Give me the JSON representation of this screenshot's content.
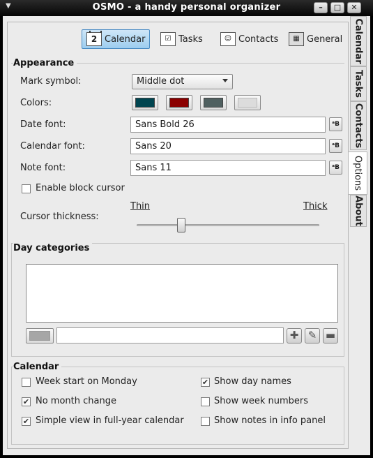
{
  "window": {
    "title": "OSMO - a handy personal organizer",
    "controls": [
      "minimize",
      "maximize",
      "close"
    ]
  },
  "tabs": [
    {
      "label": "Calendar",
      "icon": "calendar-icon",
      "active": true
    },
    {
      "label": "Tasks",
      "icon": "tasks-icon",
      "active": false
    },
    {
      "label": "Contacts",
      "icon": "contacts-icon",
      "active": false
    },
    {
      "label": "General",
      "icon": "general-icon",
      "active": false
    }
  ],
  "calendar_tab_icon_text": "2",
  "appearance": {
    "legend": "Appearance",
    "mark_symbol_label": "Mark symbol:",
    "mark_symbol_value": "Middle dot",
    "colors_label": "Colors:",
    "colors": [
      "#004550",
      "#8b0000",
      "#506060",
      "#dcdcdc"
    ],
    "date_font_label": "Date font:",
    "date_font_value": "Sans Bold 26",
    "calendar_font_label": "Calendar font:",
    "calendar_font_value": "Sans 20",
    "note_font_label": "Note font:",
    "note_font_value": "Sans 11",
    "block_cursor_label": "Enable block cursor",
    "block_cursor_checked": false,
    "cursor_thickness_label": "Cursor thickness:",
    "thin_label": "Thin",
    "thick_label": "Thick",
    "thickness_level": 0.25
  },
  "day_categories": {
    "legend": "Day categories",
    "entry_value": "",
    "swatch_color": "#a6a6a6"
  },
  "calendar": {
    "legend": "Calendar",
    "options": [
      {
        "label": "Week start on Monday",
        "checked": false
      },
      {
        "label": "Show day names",
        "checked": true
      },
      {
        "label": "No month change",
        "checked": true
      },
      {
        "label": "Show week numbers",
        "checked": false
      },
      {
        "label": "Simple view in full-year calendar",
        "checked": true
      },
      {
        "label": "Show notes in info panel",
        "checked": false
      }
    ]
  },
  "sidebar_tabs": [
    {
      "label": "Calendar",
      "active": false
    },
    {
      "label": "Tasks",
      "active": false
    },
    {
      "label": "Contacts",
      "active": false
    },
    {
      "label": "Options",
      "active": true
    },
    {
      "label": "About",
      "active": false
    }
  ]
}
